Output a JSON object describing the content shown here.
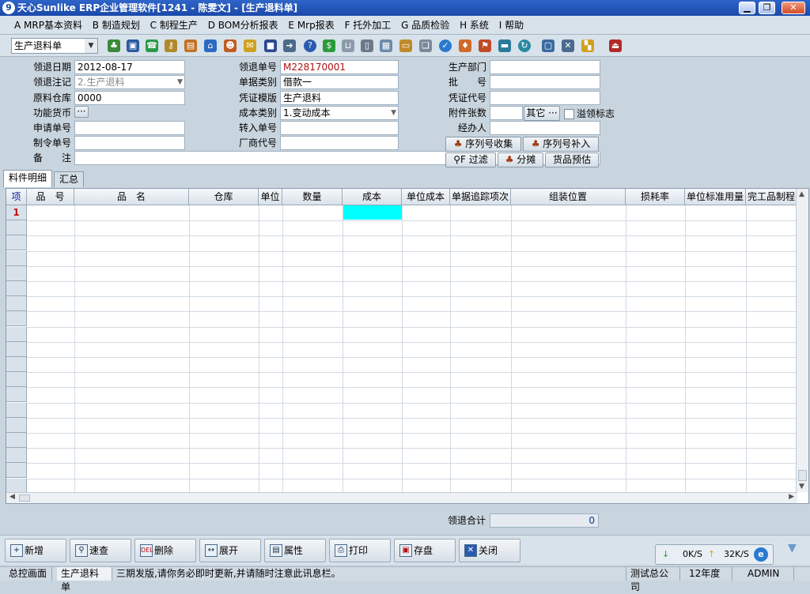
{
  "window": {
    "title": "天心Sunlike ERP企业管理软件[1241 - 陈雯文] - [生产退料单]"
  },
  "menu": [
    "A MRP基本资料",
    "B 制造规划",
    "C 制程生产",
    "D BOM分析报表",
    "E Mrp报表",
    "F 托外加工",
    "G 品质检验",
    "H 系统",
    "I 帮助"
  ],
  "toolbar": {
    "doc_type": "生产退料单"
  },
  "form": {
    "ret_date_label": "领退日期",
    "ret_date": "2012-08-17",
    "ret_note_label": "领退注记",
    "ret_note": "2.生产退料",
    "warehouse_label": "原料仓库",
    "warehouse": "0000",
    "currency_label": "功能货币",
    "currency_btn": "···",
    "apply_no_label": "申请单号",
    "order_no_label": "制令单号",
    "remark_label": "备　　注",
    "ret_no_label": "领退单号",
    "ret_no": "M228170001",
    "doc_cat_label": "单据类别",
    "doc_cat": "借款一",
    "voucher_tpl_label": "凭证模版",
    "voucher_tpl": "生产退料",
    "cost_type_label": "成本类别",
    "cost_type": "1.变动成本",
    "transfer_no_label": "转入单号",
    "vendor_label": "厂商代号",
    "dept_label": "生产部门",
    "batch_label": "批　　号",
    "voucher_no_label": "凭证代号",
    "attach_label": "附件张数",
    "other_btn": "其它 ···",
    "overdraw_label": "溢领标志",
    "handler_label": "经办人",
    "serial_collect": "序列号收集",
    "serial_add": "序列号补入",
    "filter": "F 过滤",
    "split": "分摊",
    "forecast": "货品预估"
  },
  "tabs": [
    "料件明细",
    "汇总"
  ],
  "grid": {
    "columns": [
      "项",
      "品　号",
      "品　名",
      "仓库",
      "单位",
      "数量",
      "成本",
      "单位成本",
      "单据追踪项次",
      "组装位置",
      "损耗率",
      "单位标准用量",
      "完工品制程"
    ],
    "rows": [
      {
        "index": "1"
      }
    ]
  },
  "summary": {
    "label": "领退合计",
    "value": "0"
  },
  "bottom_buttons": [
    "新增",
    "速查",
    "删除",
    "展开",
    "属性",
    "打印",
    "存盘",
    "关闭"
  ],
  "net": {
    "down": "0K/S",
    "up": "32K/S"
  },
  "status": {
    "home": "总控画面",
    "doc": "生产退料单",
    "message": "三期发版,请你务必即时更新,并请随时注意此讯息栏。",
    "company": "测试总公司",
    "year": "12年度",
    "user": "ADMIN"
  }
}
